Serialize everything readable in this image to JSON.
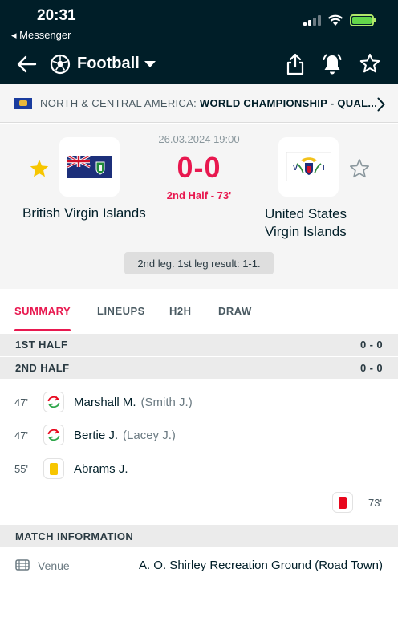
{
  "status_bar": {
    "time": "20:31",
    "back_app": "◂ Messenger"
  },
  "header": {
    "sport": "Football"
  },
  "league": {
    "region": "NORTH & CENTRAL AMERICA: ",
    "competition": "WORLD CHAMPIONSHIP - QUAL..."
  },
  "match": {
    "datetime": "26.03.2024 19:00",
    "score": "0-0",
    "status": "2nd Half - 73'",
    "home_team": "British Virgin Islands",
    "away_team_line1": "United States",
    "away_team_line2": "Virgin Islands",
    "leg_note": "2nd leg. 1st leg result: 1-1."
  },
  "tabs": [
    "SUMMARY",
    "LINEUPS",
    "H2H",
    "DRAW"
  ],
  "halves": [
    {
      "label": "1ST HALF",
      "score": "0 - 0"
    },
    {
      "label": "2ND HALF",
      "score": "0 - 0"
    }
  ],
  "incidents": [
    {
      "minute": "47'",
      "type": "substitution",
      "player": "Marshall M.",
      "assist": "(Smith J.)"
    },
    {
      "minute": "47'",
      "type": "substitution",
      "player": "Bertie J.",
      "assist": "(Lacey J.)"
    },
    {
      "minute": "55'",
      "type": "yellow-card",
      "player": "Abrams J."
    }
  ],
  "away_incident": {
    "minute": "73'",
    "type": "red-card"
  },
  "match_info": {
    "heading": "MATCH INFORMATION",
    "venue_label": "Venue",
    "venue_value": "A. O. Shirley Recreation Ground (Road Town)"
  },
  "colors": {
    "header_bg": "#001e28",
    "accent": "#e8184f",
    "yellow_card": "#f7c600",
    "red_card": "#e8061c"
  }
}
